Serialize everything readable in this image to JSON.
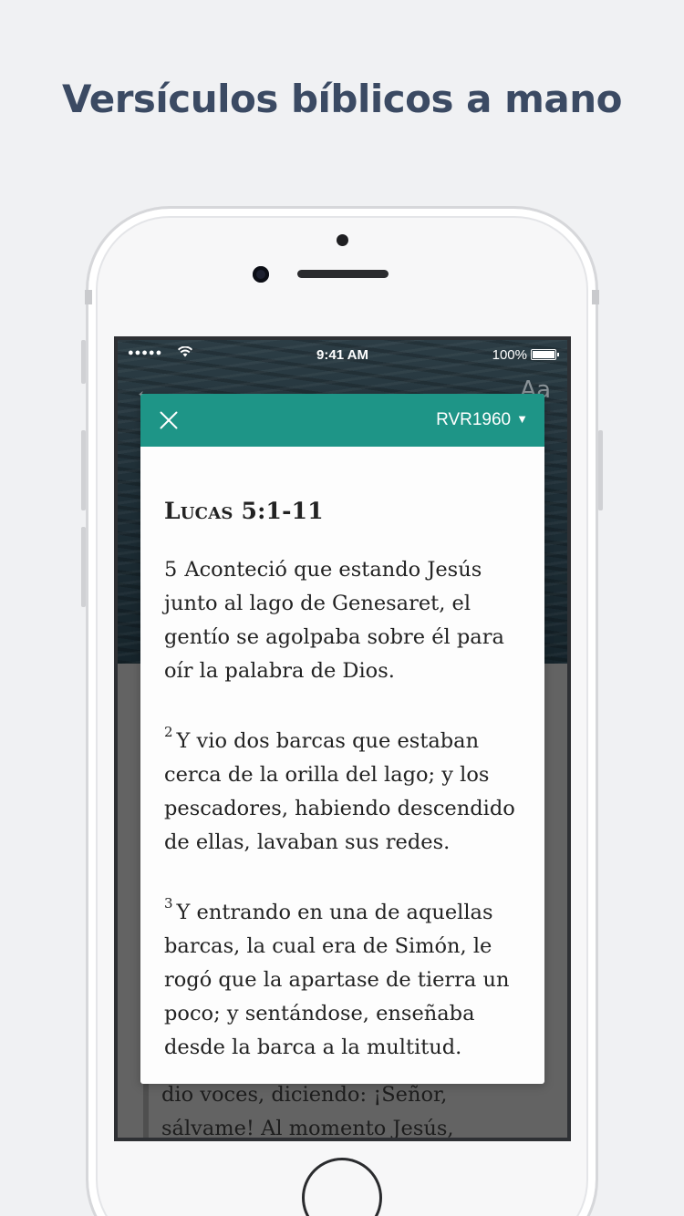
{
  "headline": "Versículos bíblicos a mano",
  "status_bar": {
    "signal": "●●●●●",
    "time": "9:41 AM",
    "battery": "100%"
  },
  "nav": {
    "back_icon": "arrow-left-icon",
    "font_toggle": "Aa"
  },
  "modal": {
    "version": "RVR1960",
    "passage_ref": "Lucas 5:1-11",
    "verses": [
      {
        "number": "5",
        "text": "Aconteció que estando Jesús junto al lago de Genesaret, el gentío se agolpaba sobre él para oír la palabra de Dios."
      },
      {
        "number": "2",
        "text": "Y vio dos barcas que estaban cerca de la orilla del lago; y los pescadores, habiendo descendido de ellas, lavaban sus redes."
      },
      {
        "number": "3",
        "text": "Y entrando en una de aquellas barcas, la cual era de Simón, le rogó que la apartase de tierra un poco; y sentándose, enseñaba desde la barca a la multitud."
      }
    ]
  },
  "background_text": "dio voces, diciendo: ¡Señor, sálvame! Al momento Jesús,",
  "colors": {
    "accent": "#1e9587",
    "headline": "#3b4a63",
    "page_bg": "#f0f1f3"
  }
}
